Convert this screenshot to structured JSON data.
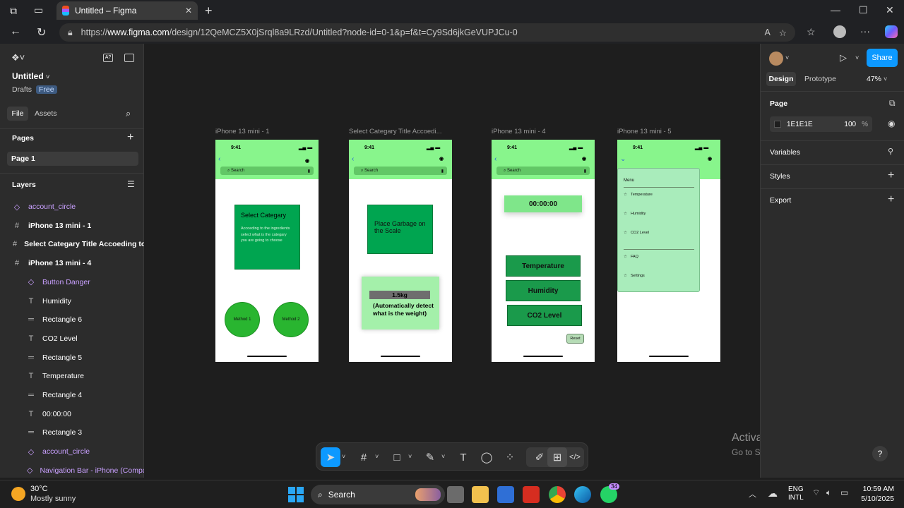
{
  "browser": {
    "tab_title": "Untitled – Figma",
    "url_prefix": "https://",
    "url_domain": "www.figma.com",
    "url_rest": "/design/12QeMCZ5X0jSrql8a9LRzd/Untitled?node-id=0-1&p=f&t=Cy9Sd6jkGeVUPJCu-0"
  },
  "left": {
    "file_name": "Untitled",
    "drafts": "Drafts",
    "plan": "Free",
    "tab_file": "File",
    "tab_assets": "Assets",
    "pages_header": "Pages",
    "page1": "Page 1",
    "layers_header": "Layers",
    "layers": [
      {
        "icon": "◇",
        "label": "account_circle",
        "kind": "component"
      },
      {
        "icon": "#",
        "label": "iPhone 13 mini - 1",
        "kind": "frame"
      },
      {
        "icon": "#",
        "label": "Select  Categary Title Accoeding to the",
        "kind": "frame"
      },
      {
        "icon": "#",
        "label": "iPhone 13 mini - 4",
        "kind": "frame"
      },
      {
        "icon": "◇",
        "label": "Button Danger",
        "kind": "component"
      },
      {
        "icon": "T",
        "label": "Humidity",
        "kind": "text"
      },
      {
        "icon": "═",
        "label": "Rectangle 6",
        "kind": "rect"
      },
      {
        "icon": "T",
        "label": "CO2 Level",
        "kind": "text"
      },
      {
        "icon": "═",
        "label": "Rectangle 5",
        "kind": "rect"
      },
      {
        "icon": "T",
        "label": "Temperature",
        "kind": "text"
      },
      {
        "icon": "═",
        "label": "Rectangle 4",
        "kind": "rect"
      },
      {
        "icon": "T",
        "label": "00:00:00",
        "kind": "text"
      },
      {
        "icon": "═",
        "label": "Rectangle 3",
        "kind": "rect"
      },
      {
        "icon": "◇",
        "label": "account_circle",
        "kind": "component"
      },
      {
        "icon": "◇",
        "label": "Navigation Bar - iPhone (Compact",
        "kind": "component"
      }
    ]
  },
  "right": {
    "tab_design": "Design",
    "tab_prototype": "Prototype",
    "zoom": "47%",
    "share": "Share",
    "page_header": "Page",
    "page_color": "1E1E1E",
    "page_opacity": "100",
    "percent": "%",
    "variables": "Variables",
    "styles": "Styles",
    "export": "Export"
  },
  "canvas": {
    "frame1": {
      "title": "iPhone 13 mini - 1",
      "time": "9:41",
      "search": "Search",
      "card_title": "Select Categary",
      "card_body": "Accoeding to the ingredients select what is the categary you are going to choose",
      "method1": "Method 1",
      "method2": "Method 2"
    },
    "frame2": {
      "title": "Select  Categary Title Accoedi...",
      "time": "9:41",
      "search": "Search",
      "card_title": "Place Garbage on the Scale",
      "weight": "1.5kg",
      "weight_note": "(Automatically detect what is the weight)"
    },
    "frame3": {
      "title": "iPhone 13 mini - 4",
      "time": "9:41",
      "search": "Search",
      "timer": "00:00:00",
      "btn_temp": "Temperature",
      "btn_hum": "Humidity",
      "btn_co2": "CO2 Level",
      "reset": "Reset"
    },
    "frame4": {
      "title": "iPhone 13 mini - 5",
      "time": "9:41",
      "menu_title": "Menu",
      "menu_items": [
        "Temperature",
        "Humidity",
        "CO2 Level"
      ],
      "menu_items2": [
        "FAQ",
        "Settings"
      ]
    }
  },
  "activate": {
    "line1": "Activate Windows",
    "line2": "Go to Settings to activate Windows."
  },
  "taskbar": {
    "temp": "30°C",
    "weather": "Mostly sunny",
    "search": "Search",
    "lang1": "ENG",
    "lang2": "INTL",
    "time": "10:59 AM",
    "date": "5/10/2025",
    "badge": "34"
  }
}
